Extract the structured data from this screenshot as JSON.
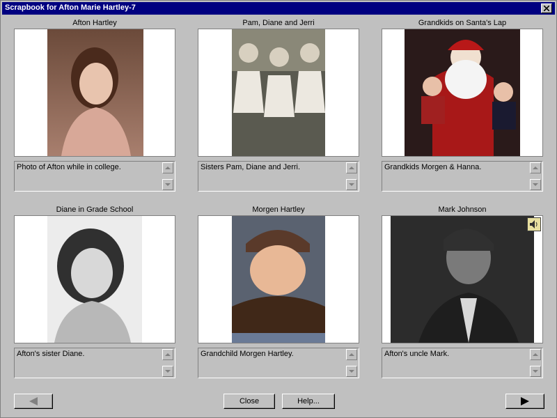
{
  "window": {
    "title": "Scrapbook for Afton Marie Hartley-7"
  },
  "cells": [
    {
      "title": "Afton Hartley",
      "description": "Photo of Afton while in college."
    },
    {
      "title": "Pam, Diane and Jerri",
      "description": "Sisters Pam, Diane and Jerri."
    },
    {
      "title": "Grandkids on Santa's Lap",
      "description": "Grandkids Morgen & Hanna."
    },
    {
      "title": "Diane in Grade School",
      "description": "Afton's sister Diane."
    },
    {
      "title": "Morgen Hartley",
      "description": "Grandchild Morgen Hartley."
    },
    {
      "title": "Mark Johnson",
      "description": "Afton's uncle Mark."
    }
  ],
  "buttons": {
    "close": "Close",
    "help": "Help..."
  },
  "icons": {
    "close": "close-icon",
    "prev": "left-arrow-icon",
    "next": "right-arrow-icon",
    "speaker": "speaker-icon"
  }
}
